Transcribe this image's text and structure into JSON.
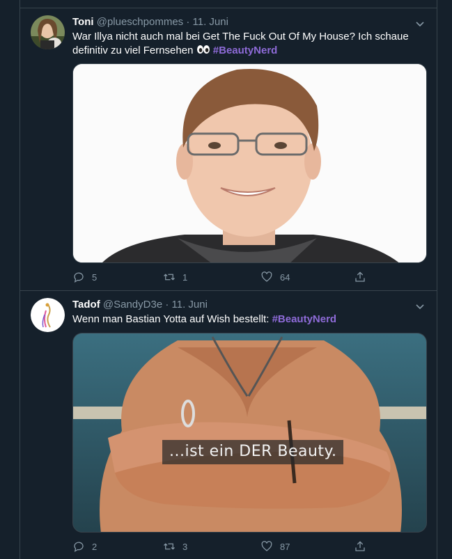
{
  "tweets": [
    {
      "name": "Toni",
      "handle": "@plueschpommes",
      "separator": "·",
      "date": "11. Juni",
      "text": "War Illya nicht auch mal bei Get The Fuck Out Of My House? Ich schaue definitiv zu viel Fernsehen",
      "emoji": "eyes-emoji",
      "hashtag": "#BeautyNerd",
      "media": "portrait-photo",
      "replies": "5",
      "retweets": "1",
      "likes": "64"
    },
    {
      "name": "Tadof",
      "handle": "@SandyD3e",
      "separator": "·",
      "date": "11. Juni",
      "text": "Wenn man Bastian Yotta auf Wish bestellt:",
      "hashtag": "#BeautyNerd",
      "media": "muscular-torso-photo",
      "media_caption": "...ist ein DER Beauty.",
      "replies": "2",
      "retweets": "3",
      "likes": "87"
    }
  ],
  "colors": {
    "background": "#15202b",
    "border": "#38444d",
    "muted": "#8899a6",
    "hashtag": "#8e6bd8"
  },
  "icons": [
    "chevron-down-icon",
    "reply-icon",
    "retweet-icon",
    "like-icon",
    "share-icon"
  ]
}
